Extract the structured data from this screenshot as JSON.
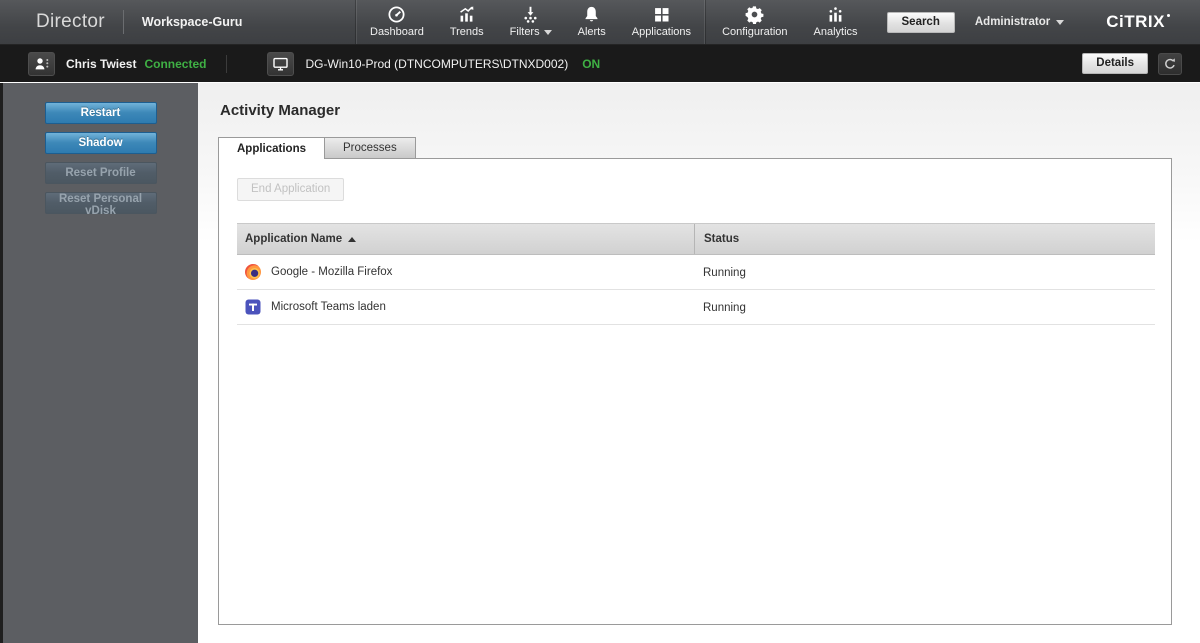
{
  "header": {
    "brand": "Director",
    "workspace": "Workspace-Guru",
    "nav_items": [
      {
        "label": "Dashboard"
      },
      {
        "label": "Trends"
      },
      {
        "label": "Filters"
      },
      {
        "label": "Alerts"
      },
      {
        "label": "Applications"
      },
      {
        "label": "Configuration"
      },
      {
        "label": "Analytics"
      }
    ],
    "search_label": "Search",
    "user_menu_label": "Administrator",
    "logo_text": "CiTRIX"
  },
  "session_bar": {
    "user_name": "Chris Twiest",
    "user_status": "Connected",
    "machine_name": "DG-Win10-Prod (DTNCOMPUTERS\\DTNXD002)",
    "machine_power": "ON",
    "details_label": "Details"
  },
  "sidebar": {
    "buttons": [
      {
        "label": "Restart",
        "enabled": true
      },
      {
        "label": "Shadow",
        "enabled": true
      },
      {
        "label": "Reset Profile",
        "enabled": false
      },
      {
        "label": "Reset Personal vDisk",
        "enabled": false
      }
    ]
  },
  "main": {
    "title": "Activity Manager",
    "tabs": [
      {
        "label": "Applications",
        "active": true
      },
      {
        "label": "Processes",
        "active": false
      }
    ],
    "end_application_label": "End Application",
    "table": {
      "columns": {
        "app": "Application Name",
        "status": "Status"
      },
      "sort": {
        "column": "Application Name",
        "direction": "asc"
      },
      "rows": [
        {
          "app": "Google - Mozilla Firefox",
          "icon": "firefox-icon",
          "status": "Running"
        },
        {
          "app": "Microsoft Teams laden",
          "icon": "teams-icon",
          "status": "Running"
        }
      ]
    }
  },
  "colors": {
    "topbar": "#4a4c4f",
    "session_bar": "#1a1a1a",
    "sidebar": "#5c5e62",
    "accent_blue": "#3d88b8",
    "status_green": "#3fb044",
    "panel_border": "#9a9a9a"
  }
}
